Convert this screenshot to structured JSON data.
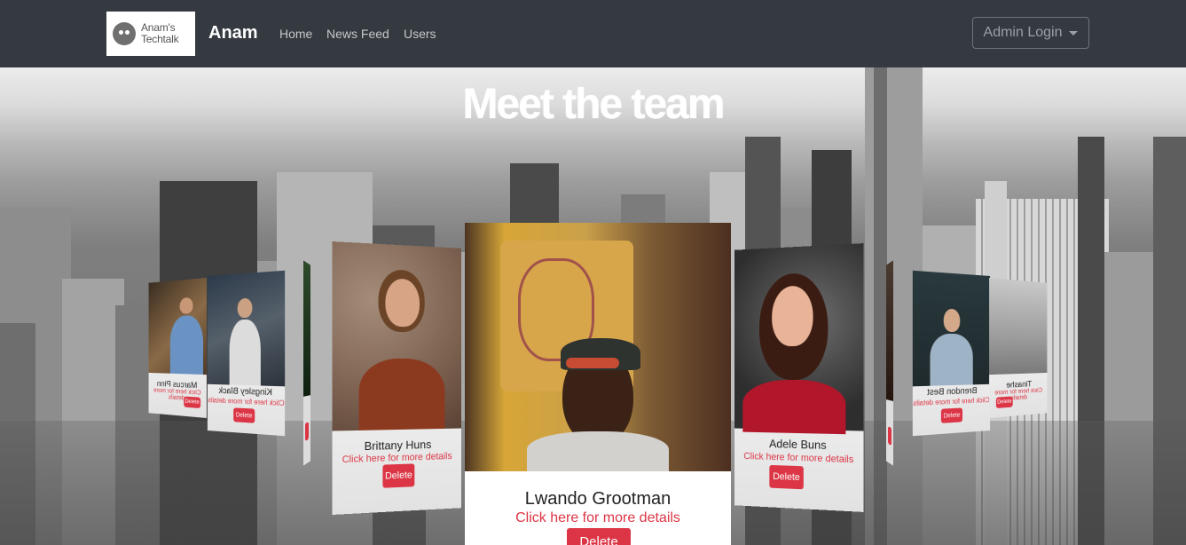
{
  "navbar": {
    "logo_text_line1": "Anam's",
    "logo_text_line2": "Techtalk",
    "brand": "Anam",
    "links": [
      "Home",
      "News Feed",
      "Users"
    ],
    "admin_button": "Admin Login"
  },
  "hero": {
    "title": "Meet the team"
  },
  "cards": [
    {
      "name": "Lwando Grootman",
      "link": "Click here for more details",
      "delete": "Delete"
    },
    {
      "name": "Brittany Huns",
      "link": "Click here for more details",
      "delete": "Delete"
    },
    {
      "name": "Adele Buns",
      "link": "Click here for more details",
      "delete": "Delete"
    },
    {
      "name": "Kingsley Black",
      "link": "Click here for more details",
      "delete": "Delete"
    },
    {
      "name": "Brendon Best",
      "link": "Click here for more details",
      "delete": "Delete"
    },
    {
      "name": "Marcus Pinn",
      "link": "Click here for more details",
      "delete": "Delete"
    },
    {
      "name": "Tinashe",
      "link": "Click here for more details",
      "delete": "Delete"
    }
  ],
  "colors": {
    "navbar": "#343a40",
    "delete_button": "#dc3545",
    "link": "#dc3545"
  }
}
